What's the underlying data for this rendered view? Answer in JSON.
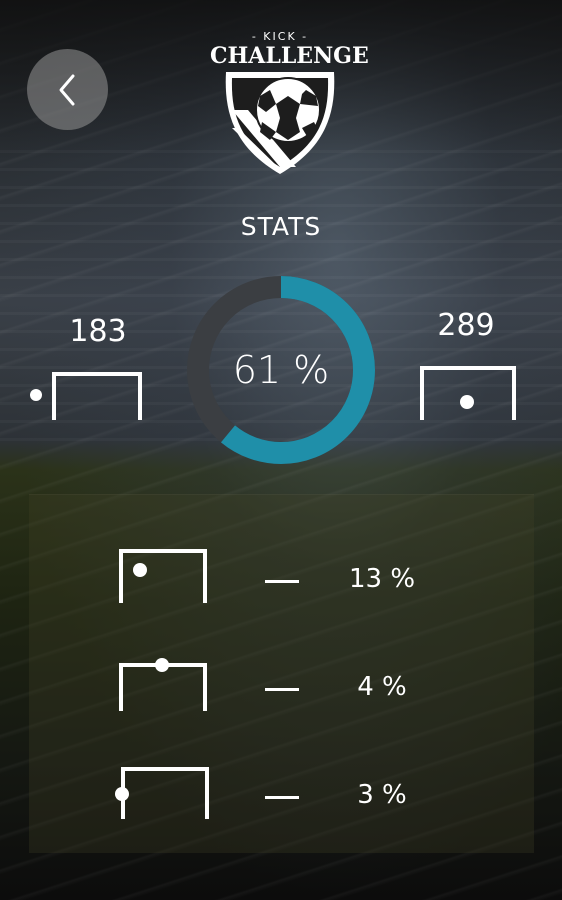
{
  "header": {
    "logo_top": "- KICK -",
    "logo_main": "CHALLENGE",
    "back_icon": "chevron-left-icon"
  },
  "stats": {
    "title": "STATS",
    "percent_label": "61 %",
    "percent_value": 61,
    "left_count": "183",
    "right_count": "289"
  },
  "breakdown": [
    {
      "icon": "goal-top-left-icon",
      "percent": "13 %"
    },
    {
      "icon": "goal-crossbar-icon",
      "percent": "4 %"
    },
    {
      "icon": "goal-post-icon",
      "percent": "3 %"
    }
  ],
  "colors": {
    "accent": "#1f8fa9",
    "donut_track": "#3b3e42",
    "back_button": "#8a8a8a"
  }
}
